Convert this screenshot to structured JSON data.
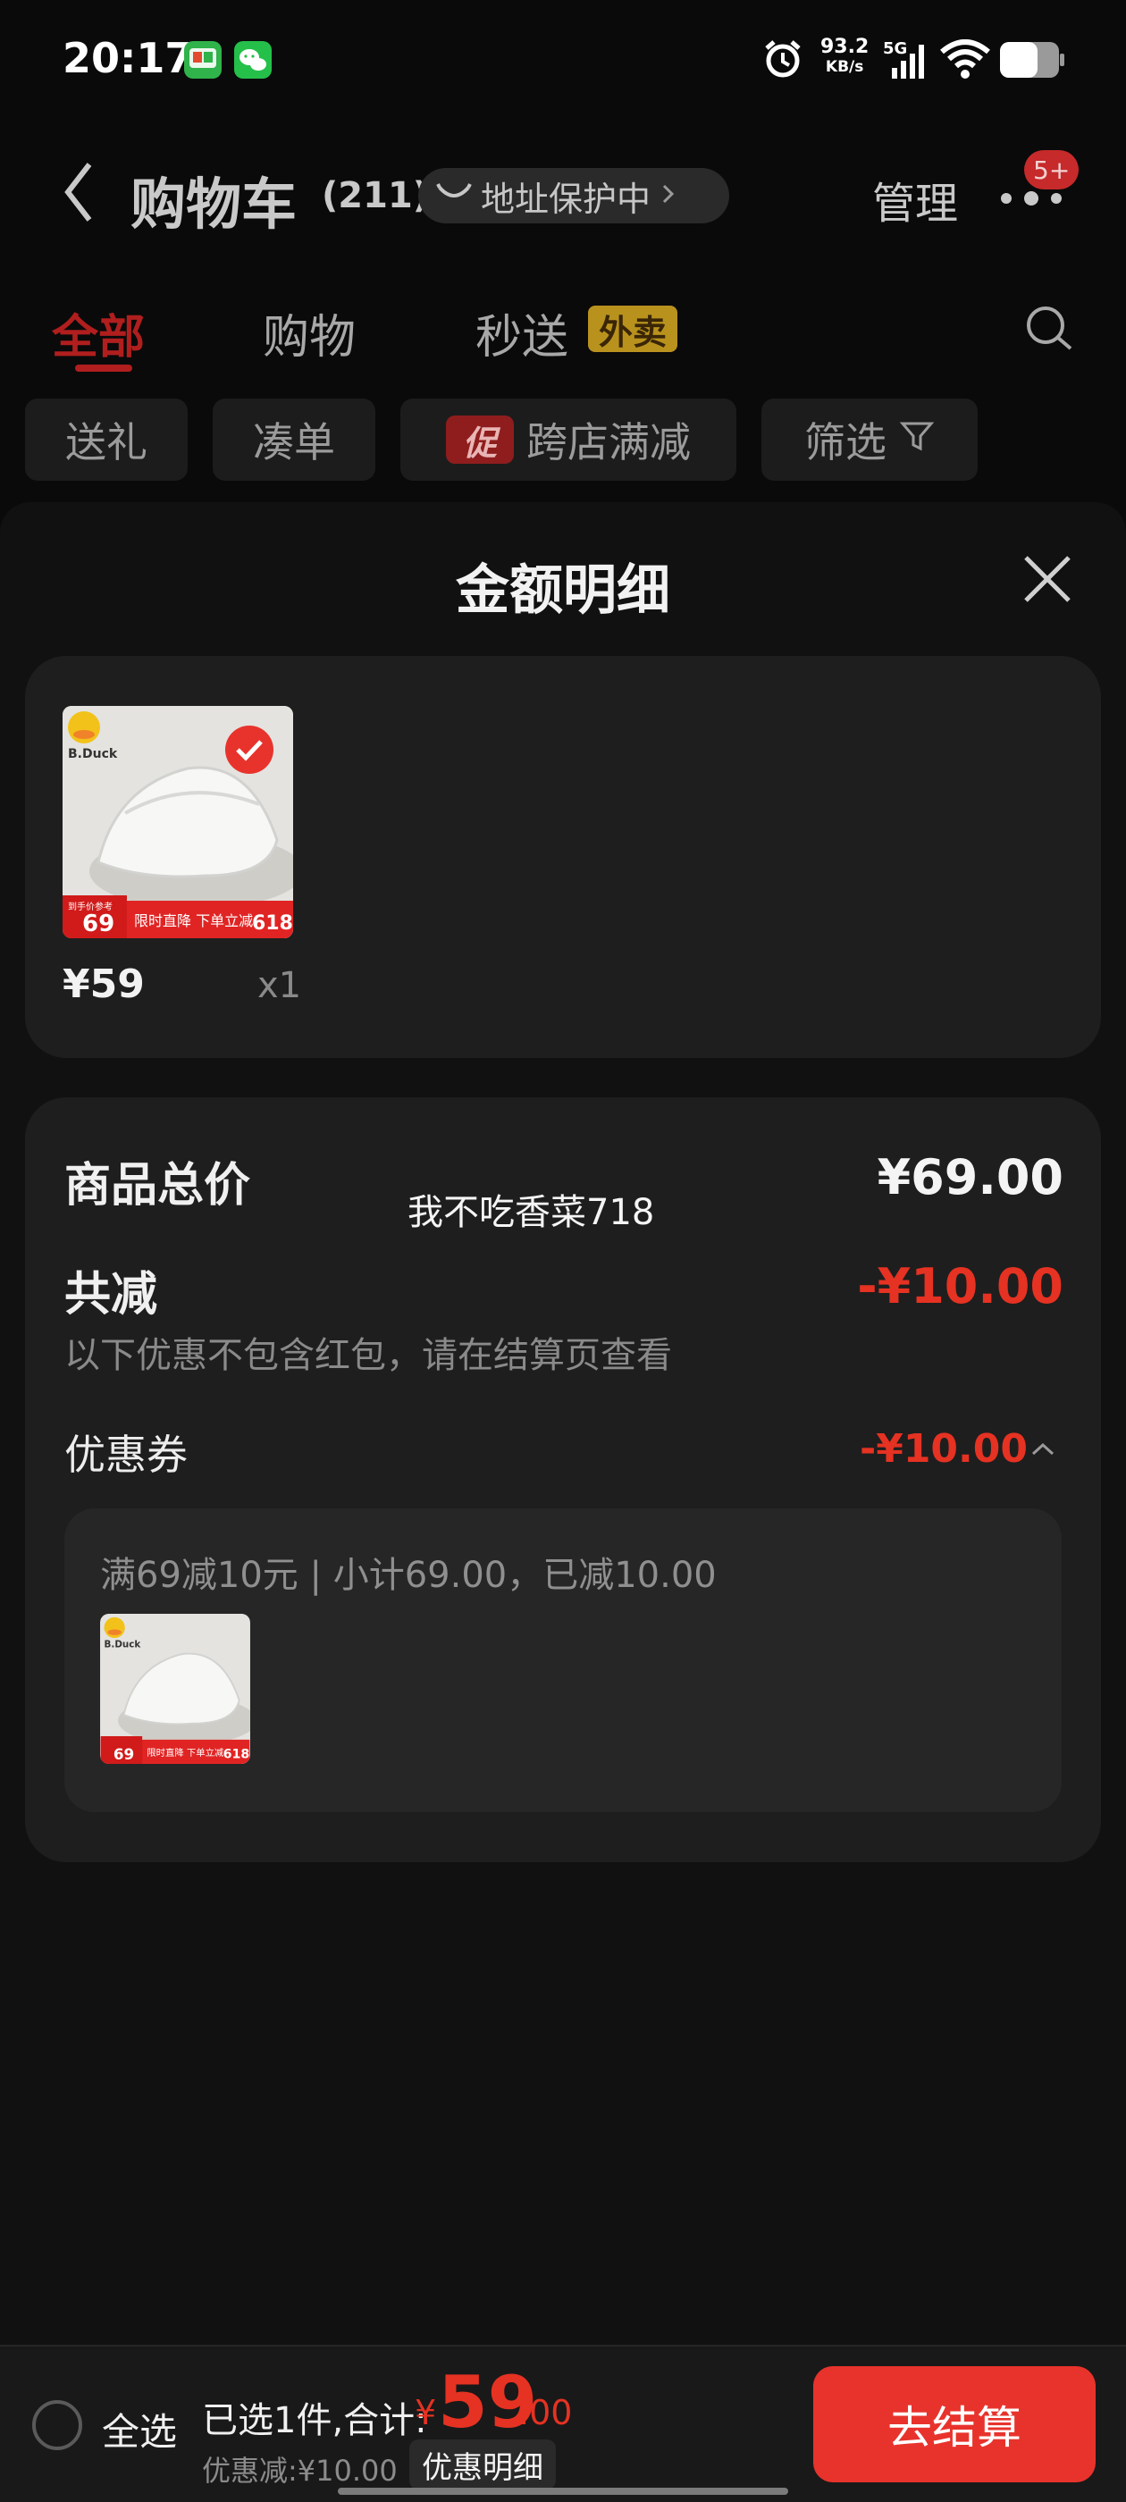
{
  "status_bar": {
    "time": "20:17",
    "net_speed_value": "93.2",
    "net_speed_unit": "KB/s",
    "network": "5G",
    "icons": [
      "app-badge-icon",
      "wechat-icon",
      "alarm-icon",
      "signal-icon",
      "wifi-icon",
      "battery-icon"
    ]
  },
  "header": {
    "title": "购物车",
    "count": "(211)",
    "address_protection": "地址保护中",
    "manage": "管理",
    "more_badge": "5+"
  },
  "tabs": [
    {
      "label": "全部",
      "active": true
    },
    {
      "label": "购物",
      "active": false
    },
    {
      "label": "秒送",
      "active": false
    }
  ],
  "waimai_badge": "外卖",
  "filters": [
    {
      "label": "送礼"
    },
    {
      "label": "凑单"
    },
    {
      "label": "跨店满减",
      "tag": "促"
    },
    {
      "label": "筛选"
    }
  ],
  "sheet": {
    "title": "金额明细",
    "product": {
      "price": "¥59",
      "qty": "x1",
      "thumb_text": {
        "brand": "B.Duck",
        "promo_left": "69",
        "promo_mid": "限时直降 下单立减",
        "promo_right": "618",
        "promo_small": "到手价参考"
      }
    },
    "summary": {
      "total_label": "商品总价",
      "total_value": "¥69.00",
      "reduce_label": "共减",
      "reduce_value": "-¥10.00",
      "note": "以下优惠不包含红包，请在结算页查看",
      "coupon_label": "优惠券",
      "coupon_value": "-¥10.00",
      "coupon_desc": "满69减10元 | 小计69.00，已减10.00"
    },
    "watermark": "我不吃香菜718"
  },
  "bottom_bar": {
    "select_all": "全选",
    "summary_prefix": "已选1件,合计:",
    "currency": "¥",
    "total_int": "59",
    "total_dec": ".00",
    "saved": "优惠减:¥10.00",
    "detail_button": "优惠明细",
    "checkout": "去结算"
  },
  "colors": {
    "accent_red": "#e8332c",
    "tab_active": "#b01e1e",
    "waimai_bg": "#b9921e",
    "background": "#0a0a0a"
  }
}
